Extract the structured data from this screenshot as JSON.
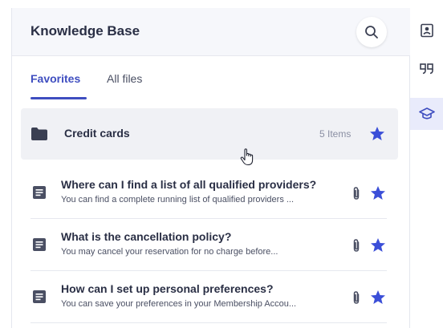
{
  "header": {
    "title": "Knowledge Base",
    "search_icon": "search-icon"
  },
  "tabs": [
    {
      "label": "Favorites",
      "active": true
    },
    {
      "label": "All files",
      "active": false
    }
  ],
  "folder": {
    "name": "Credit cards",
    "count": "5 Items",
    "starred": true
  },
  "articles": [
    {
      "title": "Where can I find a list of all qualified providers?",
      "snippet": "You can find a complete running list of qualified providers ...",
      "has_attachment": true,
      "starred": true
    },
    {
      "title": "What is the cancellation policy?",
      "snippet": "You may cancel your reservation for no charge before...",
      "has_attachment": true,
      "starred": true
    },
    {
      "title": "How can I set up personal preferences?",
      "snippet": "You can save your preferences in your Membership Accou...",
      "has_attachment": true,
      "starred": true
    }
  ],
  "rail": [
    "contact-card-icon",
    "quote-icon",
    "graduation-cap-icon"
  ],
  "colors": {
    "accent": "#3f4ec0",
    "star": "#3b4fd8",
    "text": "#2a2f45",
    "muted": "#8a8fa3"
  }
}
